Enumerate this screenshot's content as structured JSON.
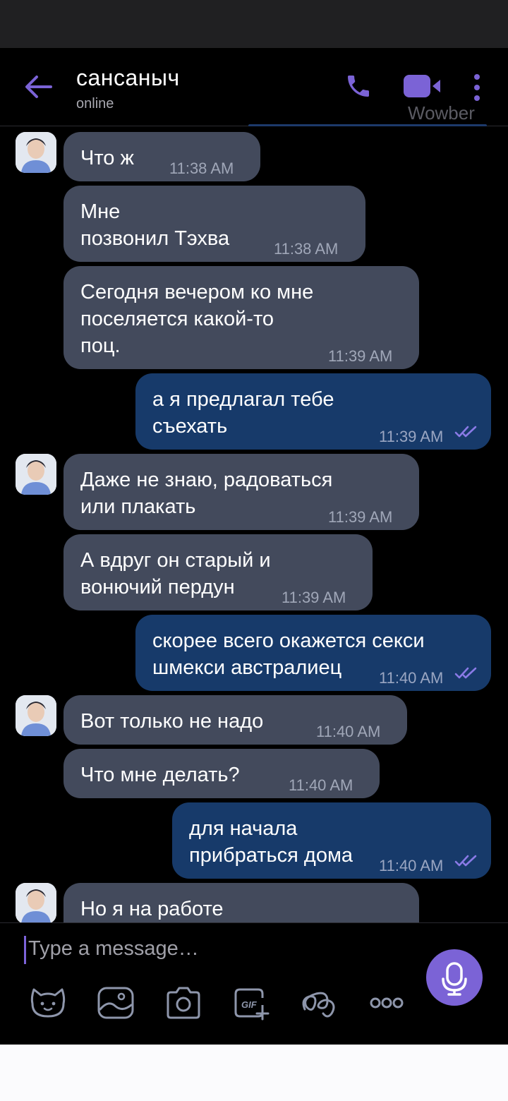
{
  "header": {
    "title": "сансаныч",
    "status": "online",
    "watermark": "Wowber",
    "icons": [
      "back-arrow-icon",
      "phone-icon",
      "video-camera-icon",
      "more-vert-icon"
    ]
  },
  "messages": [
    {
      "dir": "in",
      "text": "Что ж",
      "time": "11:38 AM",
      "avatar": true
    },
    {
      "dir": "in",
      "text": "Мне\nпозвонил Тэхва",
      "time": "11:38 AM",
      "avatar": false
    },
    {
      "dir": "in",
      "text": "Сегодня вечером ко мне\nпоселяется какой-то\nпоц.",
      "time": "11:39 AM",
      "avatar": false
    },
    {
      "dir": "out",
      "text": "а я предлагал тебе\nсъехать",
      "time": "11:39 AM",
      "read": true
    },
    {
      "dir": "in",
      "text": "Даже не знаю, радоваться\nили плакать",
      "time": "11:39 AM",
      "avatar": true
    },
    {
      "dir": "in",
      "text": "А вдруг он старый и\nвонючий пердун",
      "time": "11:39 AM",
      "avatar": false
    },
    {
      "dir": "out",
      "text": "скорее всего окажется секси\nшмекси австралиец",
      "time": "11:40 AM",
      "read": true
    },
    {
      "dir": "in",
      "text": "Вот только не надо",
      "time": "11:40 AM",
      "avatar": true
    },
    {
      "dir": "in",
      "text": "Что мне делать?",
      "time": "11:40 AM",
      "avatar": false
    },
    {
      "dir": "out",
      "text": "для начала\nприбраться дома",
      "time": "11:40 AM",
      "read": true
    },
    {
      "dir": "in",
      "text": "Но я на работе",
      "time": "",
      "avatar": true
    }
  ],
  "composer": {
    "placeholder": "Type a message…",
    "toolbar": [
      "sticker-icon",
      "gallery-icon",
      "camera-icon",
      "gif-icon",
      "doodle-icon",
      "more-icon"
    ],
    "mic": "mic-icon"
  },
  "colors": {
    "accent": "#7b63d6",
    "incoming_bubble": "#434a5c",
    "outgoing_bubble": "#173a6a",
    "background": "#000000"
  }
}
